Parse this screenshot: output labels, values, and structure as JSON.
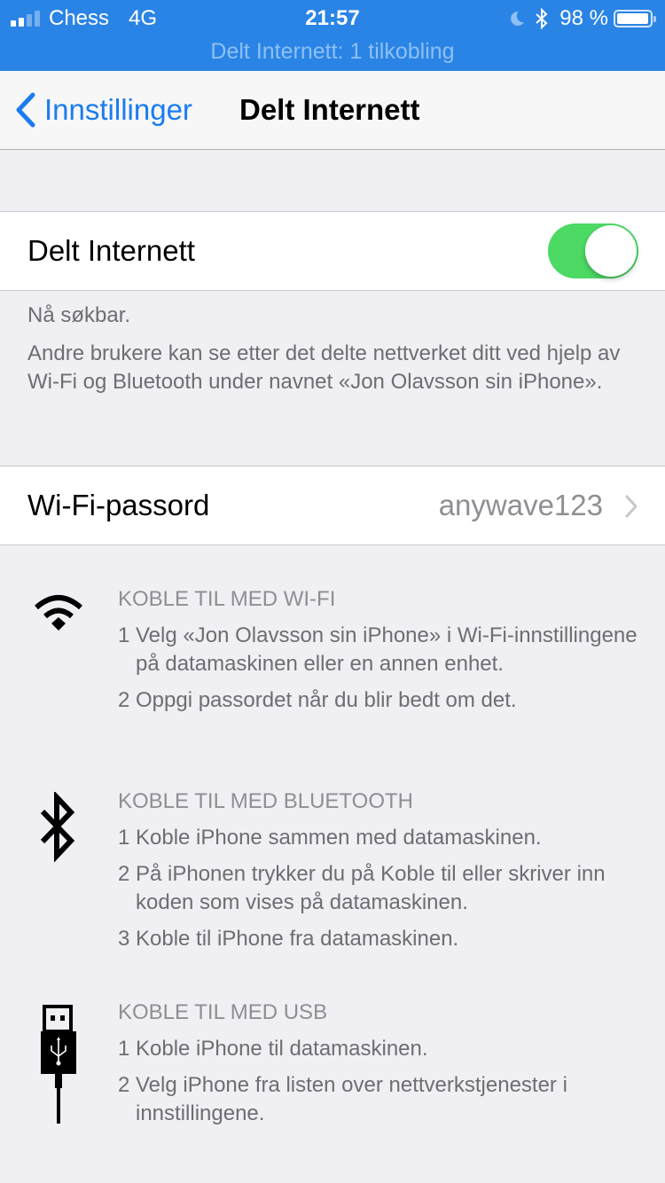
{
  "status_bar": {
    "signal_bars_filled": 2,
    "signal_bars_total": 4,
    "carrier": "Chess",
    "network": "4G",
    "time": "21:57",
    "battery_percent": "98 %",
    "battery_level": 0.98,
    "icons": [
      "do-not-disturb-moon-icon",
      "bluetooth-icon",
      "battery-icon"
    ],
    "hotspot_banner": "Delt Internett: 1 tilkobling"
  },
  "nav": {
    "back_label": "Innstillinger",
    "title": "Delt Internett"
  },
  "hotspot_toggle": {
    "label": "Delt Internett",
    "on": true,
    "on_color": "#4cd964"
  },
  "discoverable": {
    "status": "Nå søkbar.",
    "description": "Andre brukere kan se etter det delte nettverket ditt ved hjelp av Wi-Fi og Bluetooth under navnet «Jon Olavsson sin iPhone»."
  },
  "wifi_password": {
    "label": "Wi-Fi-passord",
    "value": "anywave123"
  },
  "sections": [
    {
      "icon": "wifi-icon",
      "title": "KOBLE TIL MED WI-FI",
      "steps": [
        {
          "num": "1",
          "text": "Velg «Jon Olavsson sin iPhone» i Wi-Fi-innstillingene på datamaskinen eller en annen enhet."
        },
        {
          "num": "2",
          "text": "Oppgi passordet når du blir bedt om det."
        }
      ]
    },
    {
      "icon": "bluetooth-icon",
      "title": "KOBLE TIL MED BLUETOOTH",
      "steps": [
        {
          "num": "1",
          "text": "Koble iPhone sammen med datamaskinen."
        },
        {
          "num": "2",
          "text": "På iPhonen trykker du på Koble til eller skriver inn koden som vises på datamaskinen."
        },
        {
          "num": "3",
          "text": "Koble til iPhone fra datamaskinen."
        }
      ]
    },
    {
      "icon": "usb-cable-icon",
      "title": "KOBLE TIL MED USB",
      "steps": [
        {
          "num": "1",
          "text": "Koble iPhone til datamaskinen."
        },
        {
          "num": "2",
          "text": "Velg iPhone fra listen over nettverkstjenester i innstillingene."
        }
      ]
    }
  ],
  "colors": {
    "status_bar_bg": "#2a84e5",
    "tint_blue": "#1a7cf0",
    "toggle_green": "#4cd964",
    "grouped_bg": "#efeff4",
    "secondary_text": "#6d6d72"
  }
}
